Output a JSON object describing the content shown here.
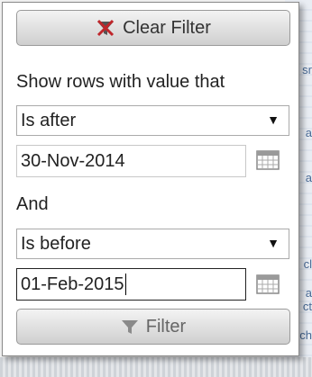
{
  "clear_filter": {
    "label": "Clear Filter"
  },
  "show_rows_label": "Show rows with value that",
  "condition1": {
    "selected": "Is after",
    "arrow": "▼"
  },
  "date1": {
    "value": "30-Nov-2014"
  },
  "join_label": "And",
  "condition2": {
    "selected": "Is before",
    "arrow": "▼"
  },
  "date2": {
    "value": "01-Feb-2015"
  },
  "filter_button": {
    "label": "Filter"
  },
  "background_fragments": [
    "sr",
    "a",
    "a",
    "cl",
    "a",
    "ct",
    "ch"
  ],
  "colors": {
    "clear_icon": "#c0262b",
    "accent_bg": "#dfe5ee"
  }
}
